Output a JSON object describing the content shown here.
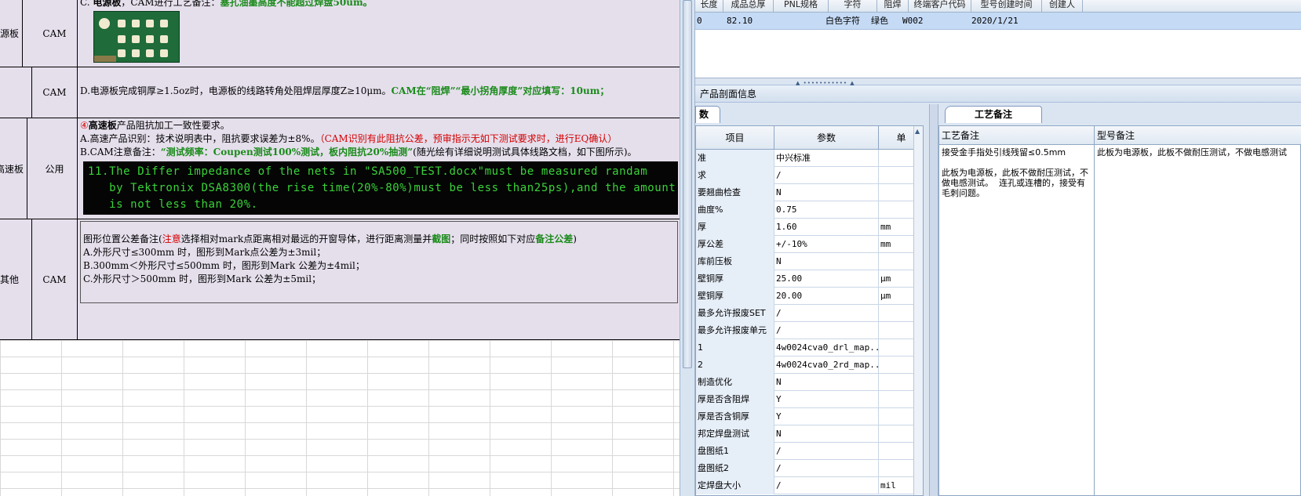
{
  "sheet": {
    "rows": [
      {
        "category": "电源板",
        "dept": "CAM",
        "line1_prefix": "C. ",
        "line1_bold": "电源板",
        "line1_mid": "，CAM进行工艺备注：",
        "line1_green": "塞孔油墨高度不能超过焊盘50um。"
      },
      {
        "category": "",
        "dept": "CAM",
        "text_plain": "D.电源板完成铜厚≥1.5oz时，电源板的线路转角处阻焊层厚度Z≥10μm。",
        "text_green": "CAM在“阻焊”“最小拐角厚度”对应填写：10um；"
      },
      {
        "category": "高速板",
        "dept": "公用",
        "title_num": "④",
        "title_bold": "高速板",
        "title_rest": "产品阻抗加工一致性要求。",
        "line_a": "A.高速产品识别：技术说明表中，阻抗要求误差为±8%。",
        "line_a_red": "（CAM识别有此阻抗公差，预审指示无如下测试要求时，进行EQ确认）",
        "line_b": "B.CAM注意备注：",
        "line_b_green": "“测试频率：Coupen测试100%测试，板内阻抗20%抽测”",
        "line_b_rest": "(随光绘有详细说明测试具体线路文档，如下图所示)。",
        "terminal_lines": [
          "11.The Differ impedance of the nets in \"SA500_TEST.docx\"must be measured randam",
          "   by Tektronix DSA8300(the rise time(20%-80%)must be less than25ps),and the amount",
          "   is not less than 20%."
        ]
      },
      {
        "category": "其他",
        "dept": "CAM",
        "title_a": "图形位置公差备注(",
        "title_red": "注意",
        "title_b": "选择相对mark点距离相对最远的开窗导体，进行距离测量并",
        "title_green1": "截图",
        "title_c": "；同时按照如下对应",
        "title_green2": "备注公差",
        "title_d": ")",
        "lines": [
          "A.外形尺寸≤300mm 时，图形到Mark点公差为±3mil；",
          "B.300mm＜外形尺寸≤500mm 时，图形到Mark 公差为±4mil；",
          "C.外形尺寸＞500mm 时，图形到Mark 公差为±5mil；"
        ]
      }
    ]
  },
  "app": {
    "top_headers": [
      "长度",
      "成品总厚",
      "PNL规格",
      "字符",
      "阻焊",
      "终端客户代码",
      "型号创建时间",
      "创建人"
    ],
    "top_row": [
      "0",
      "82.10",
      "",
      "白色字符",
      "绿色",
      "W002",
      "2020/1/21",
      ""
    ],
    "section_title": "产品剖面信息",
    "left_tab": "数",
    "param_headers": [
      "项目",
      "参数",
      "单"
    ],
    "params": [
      {
        "k": "准",
        "v": "中兴标准",
        "u": ""
      },
      {
        "k": "求",
        "v": "/",
        "u": ""
      },
      {
        "k": "要翘曲检查",
        "v": "N",
        "u": ""
      },
      {
        "k": "曲度%",
        "v": "0.75",
        "u": ""
      },
      {
        "k": "厚",
        "v": "1.60",
        "u": "mm"
      },
      {
        "k": "厚公差",
        "v": "+/-10%",
        "u": "mm"
      },
      {
        "k": "库前压板",
        "v": "N",
        "u": ""
      },
      {
        "k": "壁铜厚",
        "v": "25.00",
        "u": "μm"
      },
      {
        "k": "壁铜厚",
        "v": "20.00",
        "u": "μm"
      },
      {
        "k": "最多允许报废SET",
        "v": "/",
        "u": ""
      },
      {
        "k": "最多允许报废单元",
        "v": "/",
        "u": ""
      },
      {
        "k": "1",
        "v": "4w0024cva0_drl_map...",
        "u": ""
      },
      {
        "k": "2",
        "v": "4w0024cva0_2rd_map...",
        "u": ""
      },
      {
        "k": "制造优化",
        "v": "N",
        "u": ""
      },
      {
        "k": "厚是否含阻焊",
        "v": "Y",
        "u": ""
      },
      {
        "k": "厚是否含铜厚",
        "v": "Y",
        "u": ""
      },
      {
        "k": "邦定焊盘测试",
        "v": "N",
        "u": ""
      },
      {
        "k": "盘图纸1",
        "v": "/",
        "u": ""
      },
      {
        "k": "盘图纸2",
        "v": "/",
        "u": ""
      },
      {
        "k": "定焊盘大小",
        "v": "/",
        "u": "mil"
      }
    ],
    "right_tab": "工艺备注",
    "notes_headers": [
      "工艺备注",
      "型号备注"
    ],
    "process_note": "接受金手指处引线残留≤0.5mm\n\n此板为电源板，此板不做耐压测试，不做电感测试。  连孔或连槽的，接受有毛刺问题。",
    "model_note": "此板为电源板，此板不做耐压测试，不做电感测试"
  }
}
